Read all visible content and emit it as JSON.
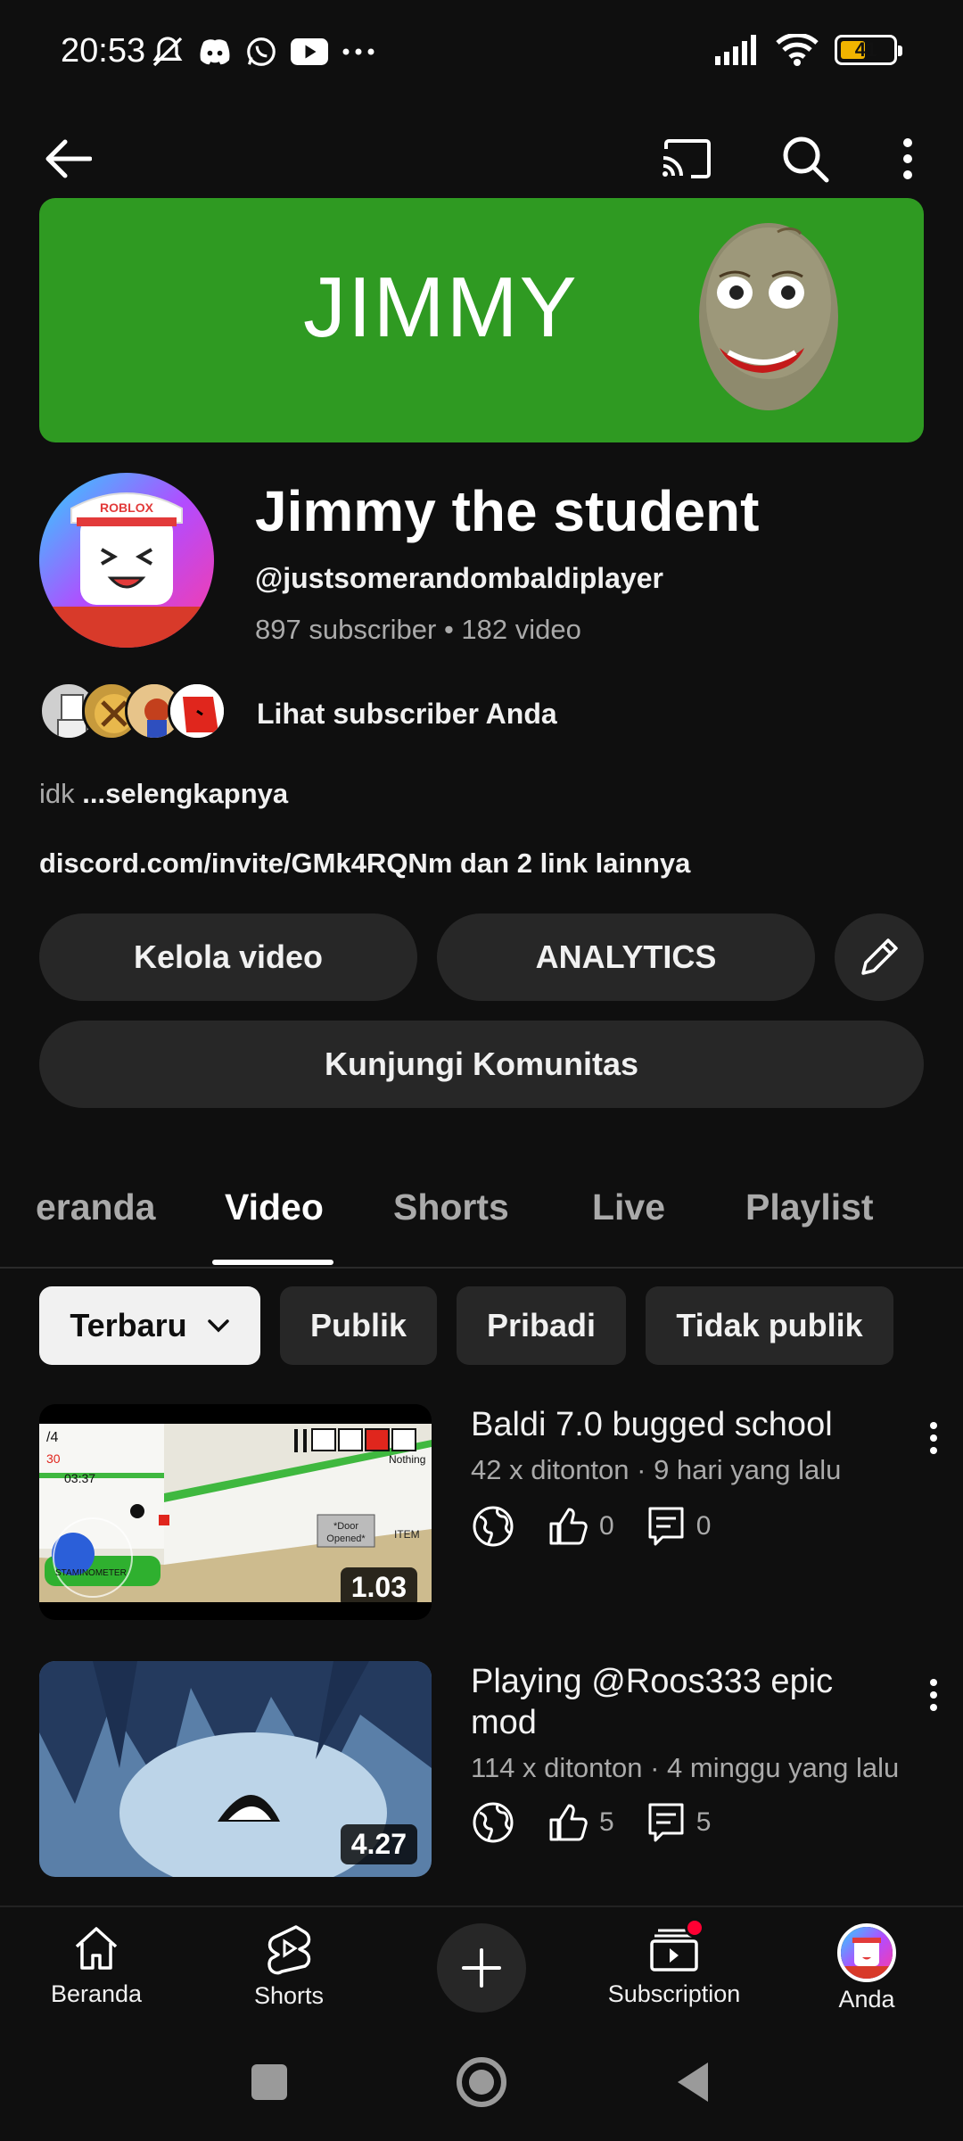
{
  "status_bar": {
    "time": "20:53",
    "battery": "41",
    "icons_left": [
      "mute-icon",
      "discord-icon",
      "whatsapp-icon",
      "youtube-icon",
      "more-dots-icon"
    ],
    "icons_right": [
      "signal-icon",
      "wifi-icon",
      "battery-icon"
    ]
  },
  "top_bar": {
    "icons": [
      "back-arrow-icon",
      "cast-icon",
      "search-icon",
      "more-vert-icon"
    ]
  },
  "banner": {
    "text": "JIMMY",
    "bg_color": "#2f9a22"
  },
  "channel": {
    "name": "Jimmy the student",
    "handle": "@justsomerandombaldiplayer",
    "stats": "897 subscriber • 182 video",
    "subscribers_link": "Lihat subscriber Anda",
    "description": "idk",
    "description_more": "...selengkapnya",
    "links": "discord.com/invite/GMk4RQNm dan 2 link lainnya"
  },
  "actions": {
    "manage_videos": "Kelola video",
    "analytics": "ANALYTICS",
    "visit_community": "Kunjungi Komunitas"
  },
  "tabs": [
    {
      "label": "eranda",
      "active": false
    },
    {
      "label": "Video",
      "active": true
    },
    {
      "label": "Shorts",
      "active": false
    },
    {
      "label": "Live",
      "active": false
    },
    {
      "label": "Playlist",
      "active": false
    }
  ],
  "filters": {
    "sort": "Terbaru",
    "chips": [
      "Publik",
      "Pribadi",
      "Tidak publik"
    ]
  },
  "videos": [
    {
      "title": "Baldi 7.0 bugged school",
      "meta": "42 x ditonton · 9 hari yang lalu",
      "likes": "0",
      "comments": "0",
      "duration": "1.03",
      "thumb_overlay": {
        "counter": "/4",
        "stat1": "30",
        "time": "03:37",
        "nothing": "Nothing",
        "door1": "*Door",
        "door2": "Opened*",
        "item": "ITEM",
        "stamina": "STAMINOMETER"
      }
    },
    {
      "title": "Playing @Roos333 epic mod",
      "meta": "114 x ditonton · 4 minggu yang lalu",
      "likes": "5",
      "comments": "5",
      "duration": "4.27"
    }
  ],
  "bottom_nav": {
    "home": "Beranda",
    "shorts": "Shorts",
    "subscriptions": "Subscription",
    "you": "Anda"
  },
  "avatar_text": "ROBLOX",
  "colors": {
    "background": "#0f0f0f",
    "pill": "#272727",
    "notification_dot": "#ff0033"
  }
}
